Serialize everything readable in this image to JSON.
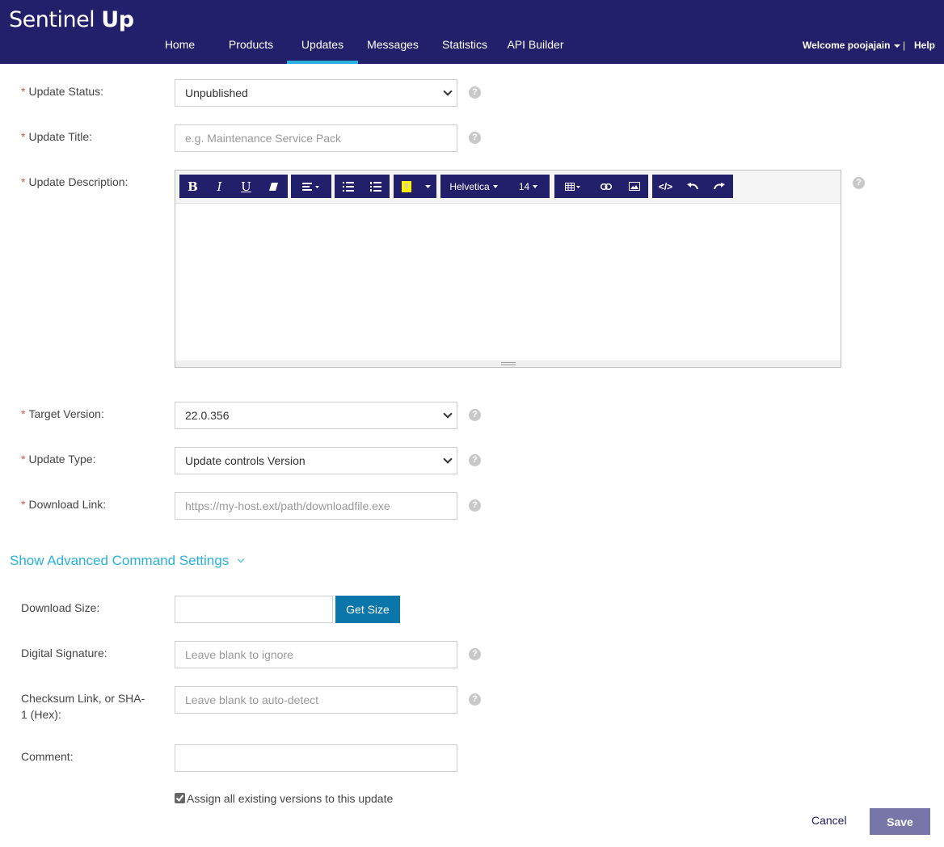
{
  "header": {
    "brand_regular": "Sentinel ",
    "brand_bold": "Up",
    "nav": [
      "Home",
      "Products",
      "Updates",
      "Messages",
      "Statistics",
      "API Builder"
    ],
    "active_tab": "Updates",
    "welcome": "Welcome poojajain",
    "separator": "|",
    "help": "Help"
  },
  "form": {
    "update_status": {
      "label": "Update Status:",
      "value": "Unpublished"
    },
    "update_title": {
      "label": "Update Title:",
      "placeholder": "e.g. Maintenance Service Pack"
    },
    "update_description": {
      "label": "Update Description:"
    },
    "editor_toolbar": {
      "font": "Helvetica",
      "size": "14"
    },
    "target_version": {
      "label": "Target Version:",
      "value": "22.0.356"
    },
    "update_type": {
      "label": "Update Type:",
      "value": "Update controls Version"
    },
    "download_link": {
      "label": "Download Link:",
      "placeholder": "https://my-host.ext/path/downloadfile.exe"
    },
    "required_marker": "*",
    "help_glyph": "?"
  },
  "advanced": {
    "toggle_label": "Show Advanced Command Settings",
    "download_size": {
      "label": "Download Size:",
      "value": "",
      "button": "Get Size"
    },
    "digital_signature": {
      "label": "Digital Signature:",
      "placeholder": "Leave blank to ignore"
    },
    "checksum": {
      "label_line1": "Checksum Link, or SHA-",
      "label_line2": "1 (Hex):",
      "placeholder": "Leave blank to auto-detect"
    },
    "comment": {
      "label": "Comment:",
      "value": ""
    },
    "assign_checkbox": {
      "label": "Assign all existing versions to this update",
      "checked": true
    }
  },
  "actions": {
    "cancel": "Cancel",
    "save": "Save"
  },
  "colors": {
    "header_bg": "#22206b",
    "accent": "#2ab0db",
    "primary_button": "#0a76aa",
    "save_button": "#7875a8",
    "required": "#d9534f"
  }
}
